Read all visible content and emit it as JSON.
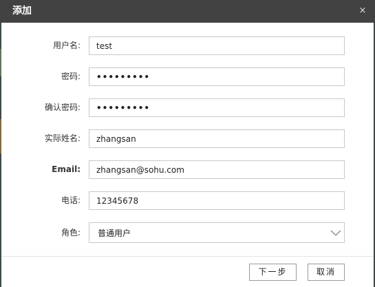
{
  "dialog": {
    "title": "添加",
    "close_glyph": "×"
  },
  "form": {
    "username": {
      "label": "用户名:",
      "value": "test"
    },
    "password": {
      "label": "密码:",
      "value": "•••••••••"
    },
    "confirm_password": {
      "label": "确认密码:",
      "value": "•••••••••"
    },
    "real_name": {
      "label": "实际姓名:",
      "value": "zhangsan"
    },
    "email": {
      "label": "Email:",
      "value": "zhangsan@sohu.com"
    },
    "phone": {
      "label": "电话:",
      "value": "12345678"
    },
    "role": {
      "label": "角色:",
      "value": "普通用户"
    }
  },
  "buttons": {
    "next_label": "下一步",
    "cancel_label": "取消"
  },
  "icons": {
    "close": "close-icon",
    "dropdown": "chevron-down-icon"
  },
  "colors": {
    "titlebar": "#424242",
    "border": "#c8c8c8"
  }
}
